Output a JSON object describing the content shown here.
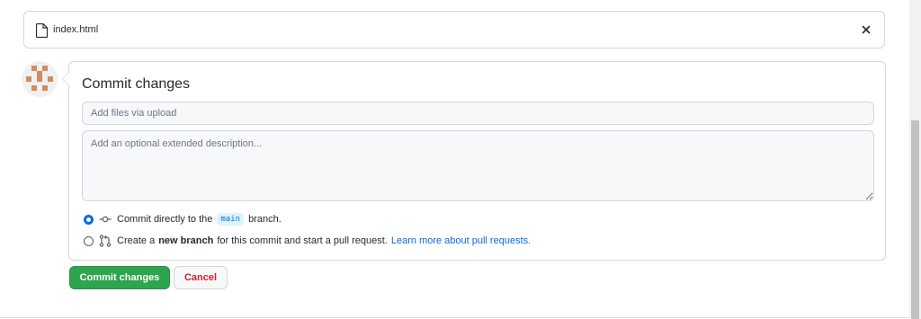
{
  "file": {
    "name": "index.html",
    "file_icon": "file-icon",
    "close_icon": "x-icon"
  },
  "commit": {
    "title": "Commit changes",
    "summary_placeholder": "Add files via upload",
    "summary_value": "",
    "description_placeholder": "Add an optional extended description...",
    "options": {
      "direct": {
        "selected": true,
        "icon": "git-commit-icon",
        "text_before": "Commit directly to the",
        "branch": "main",
        "text_after": "branch."
      },
      "new_branch": {
        "selected": false,
        "icon": "git-pull-request-icon",
        "text_before": "Create a",
        "bold": "new branch",
        "text_after": "for this commit and start a pull request.",
        "link": "Learn more about pull requests."
      }
    }
  },
  "buttons": {
    "commit_label": "Commit changes",
    "cancel_label": "Cancel"
  },
  "colors": {
    "primary_button": "#2da44e",
    "cancel_text": "#cf222e",
    "link": "#0969da",
    "avatar": "#d08c5c"
  }
}
